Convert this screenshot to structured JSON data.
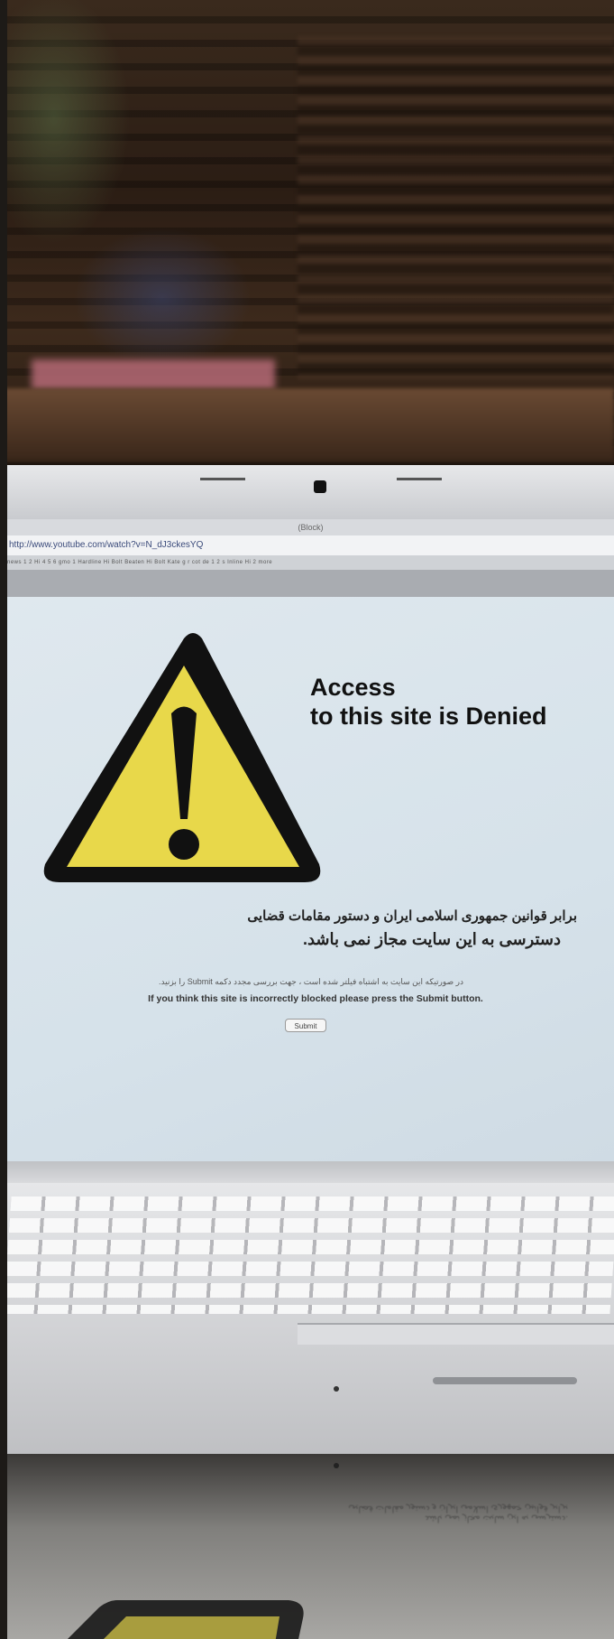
{
  "window": {
    "title": "(Block)"
  },
  "browser": {
    "address_url": "http://www.youtube.com/watch?v=N_dJ3ckesYQ",
    "bookmarks_text": "news  1  2  Hi  4  5  6  gmo  1  Hardline  Hi  Bolt  Beaten  Hi Bolt Kate  g  r  cot  de  1  2  s  Inline  Hi  2  more"
  },
  "block_page": {
    "heading_line1": "Access",
    "heading_line2": "to this site is Denied",
    "persian_line1": "برابر قوانین جمهوری اسلامی ایران و دستور مقامات قضایی",
    "persian_line2": "دسترسی به این سایت مجاز نمی باشد.",
    "persian_small": "در صورتیکه این سایت به اشتباه فیلتر شده است ، جهت بررسی مجدد دکمه Submit را بزنید.",
    "english_notice": "If you think this site is incorrectly blocked please press the Submit button.",
    "submit_label": "Submit"
  },
  "colors": {
    "warning_yellow": "#e8d84a",
    "warning_black": "#111111",
    "screen_bg": "#dbe5ec"
  },
  "icons": {
    "warning": "warning-triangle-icon"
  }
}
